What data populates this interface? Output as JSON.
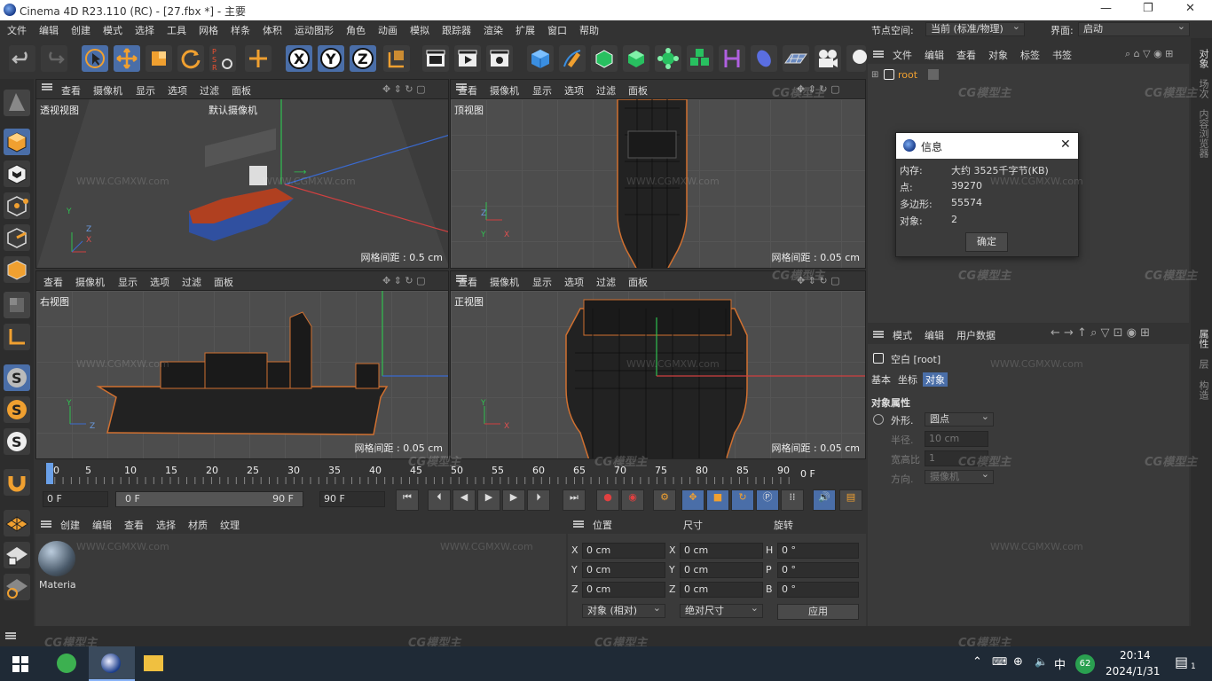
{
  "title": "Cinema 4D R23.110 (RC) - [27.fbx *] - 主要",
  "window_controls": {
    "minimize": "—",
    "maximize": "❐",
    "close": "✕"
  },
  "menu": [
    "文件",
    "编辑",
    "创建",
    "模式",
    "选择",
    "工具",
    "网格",
    "样条",
    "体积",
    "运动图形",
    "角色",
    "动画",
    "模拟",
    "跟踪器",
    "渲染",
    "扩展",
    "窗口",
    "帮助"
  ],
  "node_space": {
    "label": "节点空间:",
    "value": "当前 (标准/物理)"
  },
  "layout": {
    "label": "界面:",
    "value": "启动"
  },
  "viewport_menu": [
    "查看",
    "摄像机",
    "显示",
    "选项",
    "过滤",
    "面板"
  ],
  "viewports": [
    {
      "name": "透视视图",
      "camera": "默认摄像机",
      "grid": "网格间距 : 0.5 cm"
    },
    {
      "name": "顶视图",
      "grid": "网格间距 : 0.05 cm"
    },
    {
      "name": "右视图",
      "grid": "网格间距 : 0.05 cm"
    },
    {
      "name": "正视图",
      "grid": "网格间距 : 0.05 cm"
    }
  ],
  "axis": {
    "x": "X",
    "y": "Y",
    "z": "Z"
  },
  "object_manager": {
    "menu": [
      "文件",
      "编辑",
      "查看",
      "对象",
      "标签",
      "书签"
    ],
    "root": "root"
  },
  "info_dialog": {
    "title": "信息",
    "rows": [
      {
        "k": "内存:",
        "v": "大约 3525千字节(KB)"
      },
      {
        "k": "点:",
        "v": "39270"
      },
      {
        "k": "多边形:",
        "v": "55574"
      },
      {
        "k": "对象:",
        "v": "2"
      }
    ],
    "ok": "确定"
  },
  "attributes": {
    "menu": [
      "模式",
      "编辑",
      "用户数据"
    ],
    "object": "空白 [root]",
    "tabs": [
      "基本",
      "坐标",
      "对象"
    ],
    "section": "对象属性",
    "props": [
      {
        "label": "外形.",
        "value": "圆点"
      },
      {
        "label": "半径.",
        "value": "10 cm"
      },
      {
        "label": "宽高比",
        "value": "1"
      },
      {
        "label": "方向.",
        "value": "摄像机"
      }
    ]
  },
  "right_tabs": [
    "对象",
    "场次",
    "内容浏览器"
  ],
  "right_tabs2": [
    "属性",
    "层",
    "构造"
  ],
  "timeline": {
    "ticks": [
      "0",
      "5",
      "10",
      "15",
      "20",
      "25",
      "30",
      "35",
      "40",
      "45",
      "50",
      "55",
      "60",
      "65",
      "70",
      "75",
      "80",
      "85",
      "90"
    ],
    "end": "0 F",
    "start_field": "0 F",
    "range_start": "0 F",
    "range_end": "90 F",
    "end_field": "90 F"
  },
  "material_manager": {
    "menu": [
      "创建",
      "编辑",
      "查看",
      "选择",
      "材质",
      "纹理"
    ],
    "material": "Materia"
  },
  "coords": {
    "headers": [
      "位置",
      "尺寸",
      "旋转"
    ],
    "rows": [
      {
        "a": "X",
        "p": "0 cm",
        "b": "X",
        "s": "0 cm",
        "c": "H",
        "r": "0 °"
      },
      {
        "a": "Y",
        "p": "0 cm",
        "b": "Y",
        "s": "0 cm",
        "c": "P",
        "r": "0 °"
      },
      {
        "a": "Z",
        "p": "0 cm",
        "b": "Z",
        "s": "0 cm",
        "c": "B",
        "r": "0 °"
      }
    ],
    "mode": "对象 (相对)",
    "size_mode": "绝对尺寸",
    "apply": "应用"
  },
  "watermark": {
    "logo": "CG模型主",
    "url": "WWW.CGMXW.com"
  },
  "taskbar": {
    "time": "20:14",
    "date": "2024/1/31",
    "ime": "中",
    "badge": "62",
    "notif": "1"
  }
}
